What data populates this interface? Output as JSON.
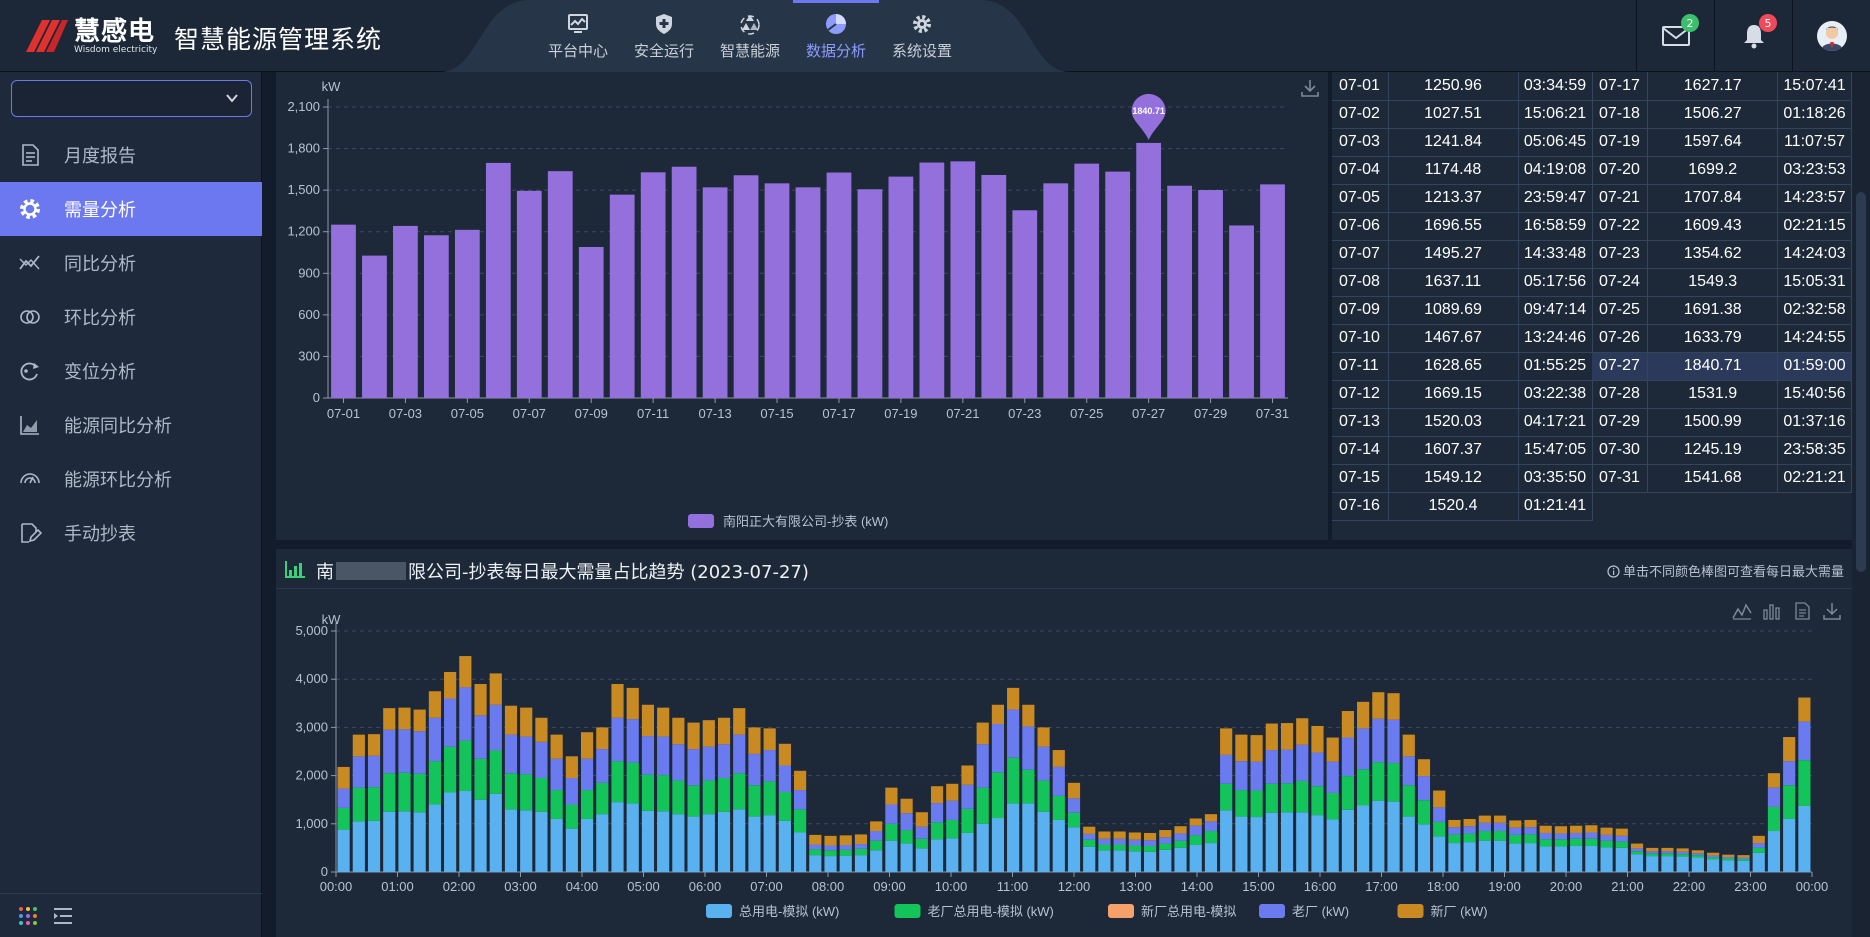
{
  "app": {
    "brand_cn": "慧感电",
    "brand_en": "Wisdom electricity",
    "title": "智慧能源管理系统"
  },
  "nav": [
    {
      "label": "平台中心",
      "icon": "monitor-icon"
    },
    {
      "label": "安全运行",
      "icon": "shield-icon"
    },
    {
      "label": "智慧能源",
      "icon": "recycle-icon"
    },
    {
      "label": "数据分析",
      "icon": "pie-chart-icon",
      "active": true
    },
    {
      "label": "系统设置",
      "icon": "gear-icon"
    }
  ],
  "header": {
    "mail_count": "2",
    "alert_count": "5"
  },
  "sidebar": {
    "select_value": "",
    "items": [
      {
        "label": "月度报告",
        "icon": "document-icon"
      },
      {
        "label": "需量分析",
        "icon": "gear-icon",
        "active": true
      },
      {
        "label": "同比分析",
        "icon": "trend-icon"
      },
      {
        "label": "环比分析",
        "icon": "rings-icon"
      },
      {
        "label": "变位分析",
        "icon": "cycle-icon"
      },
      {
        "label": "能源同比分析",
        "icon": "area-chart-icon"
      },
      {
        "label": "能源环比分析",
        "icon": "gauge-icon"
      },
      {
        "label": "手动抄表",
        "icon": "edit-icon"
      }
    ]
  },
  "colors": {
    "accent": "#6c78f0",
    "bar": "#9370db",
    "s1": "#5ab1ef",
    "s2": "#12c45a",
    "s3": "#f5a26a",
    "s4": "#6a7bf0",
    "s5": "#c98a22"
  },
  "chart_data": [
    {
      "type": "bar",
      "ylabel": "kW",
      "ylim": [
        0,
        2100
      ],
      "yticks": [
        0,
        300,
        600,
        900,
        1200,
        1500,
        1800,
        2100
      ],
      "ytick_labels": [
        "0",
        "300",
        "600",
        "900",
        "1,200",
        "1,500",
        "1,800",
        "2,100"
      ],
      "categories": [
        "07-01",
        "07-02",
        "07-03",
        "07-04",
        "07-05",
        "07-06",
        "07-07",
        "07-08",
        "07-09",
        "07-10",
        "07-11",
        "07-12",
        "07-13",
        "07-14",
        "07-15",
        "07-16",
        "07-17",
        "07-18",
        "07-19",
        "07-20",
        "07-21",
        "07-22",
        "07-23",
        "07-24",
        "07-25",
        "07-26",
        "07-27",
        "07-28",
        "07-29",
        "07-30",
        "07-31"
      ],
      "xtick_labels": [
        "07-01",
        "07-03",
        "07-05",
        "07-07",
        "07-09",
        "07-11",
        "07-13",
        "07-15",
        "07-17",
        "07-19",
        "07-21",
        "07-23",
        "07-25",
        "07-27",
        "07-29",
        "07-31"
      ],
      "series": [
        {
          "name": "南阳正大有限公司-抄表 (kW)",
          "values": [
            1250.96,
            1027.51,
            1241.84,
            1174.48,
            1213.37,
            1696.55,
            1495.27,
            1637.11,
            1089.69,
            1467.67,
            1628.65,
            1669.15,
            1520.03,
            1607.37,
            1549.12,
            1520.4,
            1627.17,
            1506.27,
            1597.64,
            1699.2,
            1707.84,
            1609.43,
            1354.62,
            1549.3,
            1691.38,
            1633.79,
            1840.71,
            1531.9,
            1500.99,
            1245.19,
            1541.68
          ]
        }
      ],
      "marker": {
        "index": 26,
        "label": "1840.71"
      },
      "legend": "bottom"
    },
    {
      "type": "bar",
      "stacked": true,
      "title": "限公司-抄表每日最大需量占比趋势 (2023-07-27)",
      "title_prefix": "南",
      "hint": "单击不同颜色棒图可查看每日最大需量",
      "ylabel": "kW",
      "ylim": [
        0,
        5000
      ],
      "yticks": [
        0,
        1000,
        2000,
        3000,
        4000,
        5000
      ],
      "ytick_labels": [
        "0",
        "1,000",
        "2,000",
        "3,000",
        "4,000",
        "5,000"
      ],
      "xtick_labels": [
        "00:00",
        "01:00",
        "02:00",
        "03:00",
        "04:00",
        "05:00",
        "06:00",
        "07:00",
        "08:00",
        "09:00",
        "10:00",
        "11:00",
        "12:00",
        "13:00",
        "14:00",
        "15:00",
        "16:00",
        "17:00",
        "18:00",
        "19:00",
        "20:00",
        "21:00",
        "22:00",
        "23:00",
        "00:00"
      ],
      "series": [
        {
          "name": "总用电-模拟 (kW)",
          "values": [
            880,
            1050,
            1060,
            1250,
            1260,
            1240,
            1400,
            1650,
            1680,
            1500,
            1620,
            1300,
            1280,
            1250,
            1100,
            900,
            1100,
            1200,
            1450,
            1420,
            1270,
            1260,
            1200,
            1150,
            1200,
            1250,
            1300,
            1150,
            1180,
            1060,
            820,
            350,
            330,
            340,
            350,
            450,
            650,
            590,
            490,
            680,
            700,
            810,
            1000,
            1120,
            1420,
            1420,
            1250,
            1080,
            930,
            520,
            450,
            450,
            430,
            420,
            460,
            500,
            560,
            600,
            1280,
            1150,
            1140,
            1230,
            1240,
            1240,
            1180,
            1090,
            1290,
            1380,
            1480,
            1460,
            1150,
            990,
            740,
            600,
            620,
            650,
            650,
            590,
            600,
            530,
            530,
            540,
            540,
            510,
            500,
            370,
            330,
            330,
            320,
            300,
            260,
            240,
            230,
            400,
            850,
            1100,
            1370
          ]
        },
        {
          "name": "老厂总用电-模拟 (kW)",
          "values": [
            450,
            700,
            700,
            800,
            800,
            800,
            900,
            950,
            1050,
            850,
            900,
            750,
            750,
            700,
            600,
            500,
            600,
            650,
            850,
            850,
            750,
            750,
            700,
            650,
            700,
            700,
            750,
            650,
            700,
            600,
            480,
            120,
            120,
            120,
            130,
            200,
            350,
            280,
            200,
            350,
            380,
            500,
            750,
            950,
            950,
            700,
            650,
            500,
            300,
            150,
            120,
            120,
            120,
            120,
            130,
            150,
            200,
            250,
            550,
            550,
            550,
            600,
            600,
            650,
            600,
            550,
            700,
            750,
            800,
            800,
            650,
            500,
            300,
            180,
            180,
            200,
            200,
            180,
            180,
            150,
            150,
            150,
            150,
            140,
            130,
            60,
            50,
            50,
            50,
            50,
            40,
            40,
            40,
            100,
            500,
            700,
            950
          ]
        },
        {
          "name": "新厂总用电-模拟",
          "values": [
            0,
            0,
            0,
            0,
            0,
            0,
            0,
            0,
            0,
            0,
            0,
            0,
            0,
            0,
            0,
            0,
            0,
            0,
            0,
            0,
            0,
            0,
            0,
            0,
            0,
            0,
            0,
            0,
            0,
            0,
            0,
            0,
            0,
            0,
            0,
            0,
            0,
            0,
            0,
            0,
            0,
            0,
            0,
            0,
            0,
            0,
            0,
            0,
            0,
            0,
            0,
            0,
            0,
            0,
            0,
            0,
            0,
            0,
            0,
            0,
            0,
            0,
            0,
            0,
            0,
            0,
            0,
            0,
            0,
            0,
            0,
            0,
            0,
            0,
            0,
            0,
            0,
            0,
            0,
            0,
            0,
            0,
            0,
            0,
            0,
            0,
            0,
            0,
            0,
            0,
            0,
            0,
            0,
            0,
            0,
            0,
            0
          ]
        },
        {
          "name": "老厂 (kW)",
          "values": [
            400,
            650,
            650,
            900,
            900,
            880,
            900,
            1000,
            1100,
            900,
            950,
            800,
            780,
            750,
            650,
            550,
            650,
            700,
            900,
            900,
            800,
            800,
            750,
            750,
            700,
            700,
            800,
            650,
            650,
            550,
            400,
            100,
            100,
            100,
            100,
            200,
            400,
            350,
            250,
            400,
            400,
            500,
            900,
            1000,
            1000,
            900,
            700,
            600,
            300,
            120,
            120,
            120,
            120,
            120,
            130,
            150,
            200,
            200,
            600,
            600,
            600,
            700,
            700,
            750,
            700,
            650,
            800,
            850,
            900,
            900,
            600,
            500,
            300,
            150,
            150,
            170,
            170,
            150,
            150,
            130,
            120,
            120,
            130,
            120,
            120,
            60,
            50,
            50,
            50,
            40,
            40,
            30,
            30,
            100,
            400,
            500,
            800
          ]
        },
        {
          "name": "新厂 (kW)",
          "values": [
            450,
            450,
            450,
            450,
            450,
            450,
            550,
            550,
            650,
            650,
            650,
            600,
            600,
            500,
            500,
            450,
            550,
            450,
            700,
            650,
            650,
            600,
            550,
            550,
            550,
            550,
            550,
            550,
            450,
            450,
            400,
            200,
            200,
            200,
            200,
            200,
            350,
            300,
            300,
            350,
            350,
            400,
            450,
            400,
            450,
            450,
            400,
            350,
            320,
            150,
            150,
            150,
            150,
            150,
            150,
            150,
            150,
            150,
            550,
            550,
            550,
            550,
            550,
            550,
            550,
            500,
            550,
            550,
            550,
            550,
            450,
            350,
            350,
            150,
            150,
            150,
            150,
            150,
            150,
            150,
            150,
            150,
            150,
            150,
            150,
            100,
            70,
            70,
            70,
            60,
            60,
            50,
            50,
            150,
            300,
            500,
            500
          ]
        }
      ],
      "legend": "bottom"
    }
  ],
  "table_left": [
    [
      "07-01",
      "1250.96",
      "03:34:59"
    ],
    [
      "07-02",
      "1027.51",
      "15:06:21"
    ],
    [
      "07-03",
      "1241.84",
      "05:06:45"
    ],
    [
      "07-04",
      "1174.48",
      "04:19:08"
    ],
    [
      "07-05",
      "1213.37",
      "23:59:47"
    ],
    [
      "07-06",
      "1696.55",
      "16:58:59"
    ],
    [
      "07-07",
      "1495.27",
      "14:33:48"
    ],
    [
      "07-08",
      "1637.11",
      "05:17:56"
    ],
    [
      "07-09",
      "1089.69",
      "09:47:14"
    ],
    [
      "07-10",
      "1467.67",
      "13:24:46"
    ],
    [
      "07-11",
      "1628.65",
      "01:55:25"
    ],
    [
      "07-12",
      "1669.15",
      "03:22:38"
    ],
    [
      "07-13",
      "1520.03",
      "04:17:21"
    ],
    [
      "07-14",
      "1607.37",
      "15:47:05"
    ],
    [
      "07-15",
      "1549.12",
      "03:35:50"
    ],
    [
      "07-16",
      "1520.4",
      "01:21:41"
    ]
  ],
  "table_right": [
    [
      "07-17",
      "1627.17",
      "15:07:41"
    ],
    [
      "07-18",
      "1506.27",
      "01:18:26"
    ],
    [
      "07-19",
      "1597.64",
      "11:07:57"
    ],
    [
      "07-20",
      "1699.2",
      "03:23:53"
    ],
    [
      "07-21",
      "1707.84",
      "14:23:57"
    ],
    [
      "07-22",
      "1609.43",
      "02:21:15"
    ],
    [
      "07-23",
      "1354.62",
      "14:24:03"
    ],
    [
      "07-24",
      "1549.3",
      "15:05:31"
    ],
    [
      "07-25",
      "1691.38",
      "02:32:58"
    ],
    [
      "07-26",
      "1633.79",
      "14:24:55"
    ],
    [
      "07-27",
      "1840.71",
      "01:59:00"
    ],
    [
      "07-28",
      "1531.9",
      "15:40:56"
    ],
    [
      "07-29",
      "1500.99",
      "01:37:16"
    ],
    [
      "07-30",
      "1245.19",
      "23:58:35"
    ],
    [
      "07-31",
      "1541.68",
      "02:21:21"
    ]
  ]
}
